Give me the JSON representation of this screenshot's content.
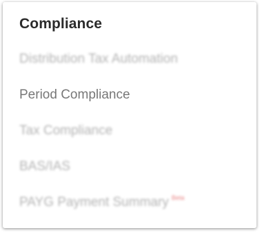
{
  "menu": {
    "title": "Compliance",
    "items": [
      {
        "label": "Distribution Tax Automation",
        "blurred": true
      },
      {
        "label": "Period Compliance",
        "blurred": false
      },
      {
        "label": "Tax Compliance",
        "blurred": true
      },
      {
        "label": "BAS/IAS",
        "blurred": true
      },
      {
        "label": "PAYG Payment Summary",
        "blurred": true,
        "badge": "Beta"
      }
    ]
  },
  "colors": {
    "title": "#2b2b2b",
    "item_text": "#8a8a8a",
    "badge": "#e05a5a"
  }
}
